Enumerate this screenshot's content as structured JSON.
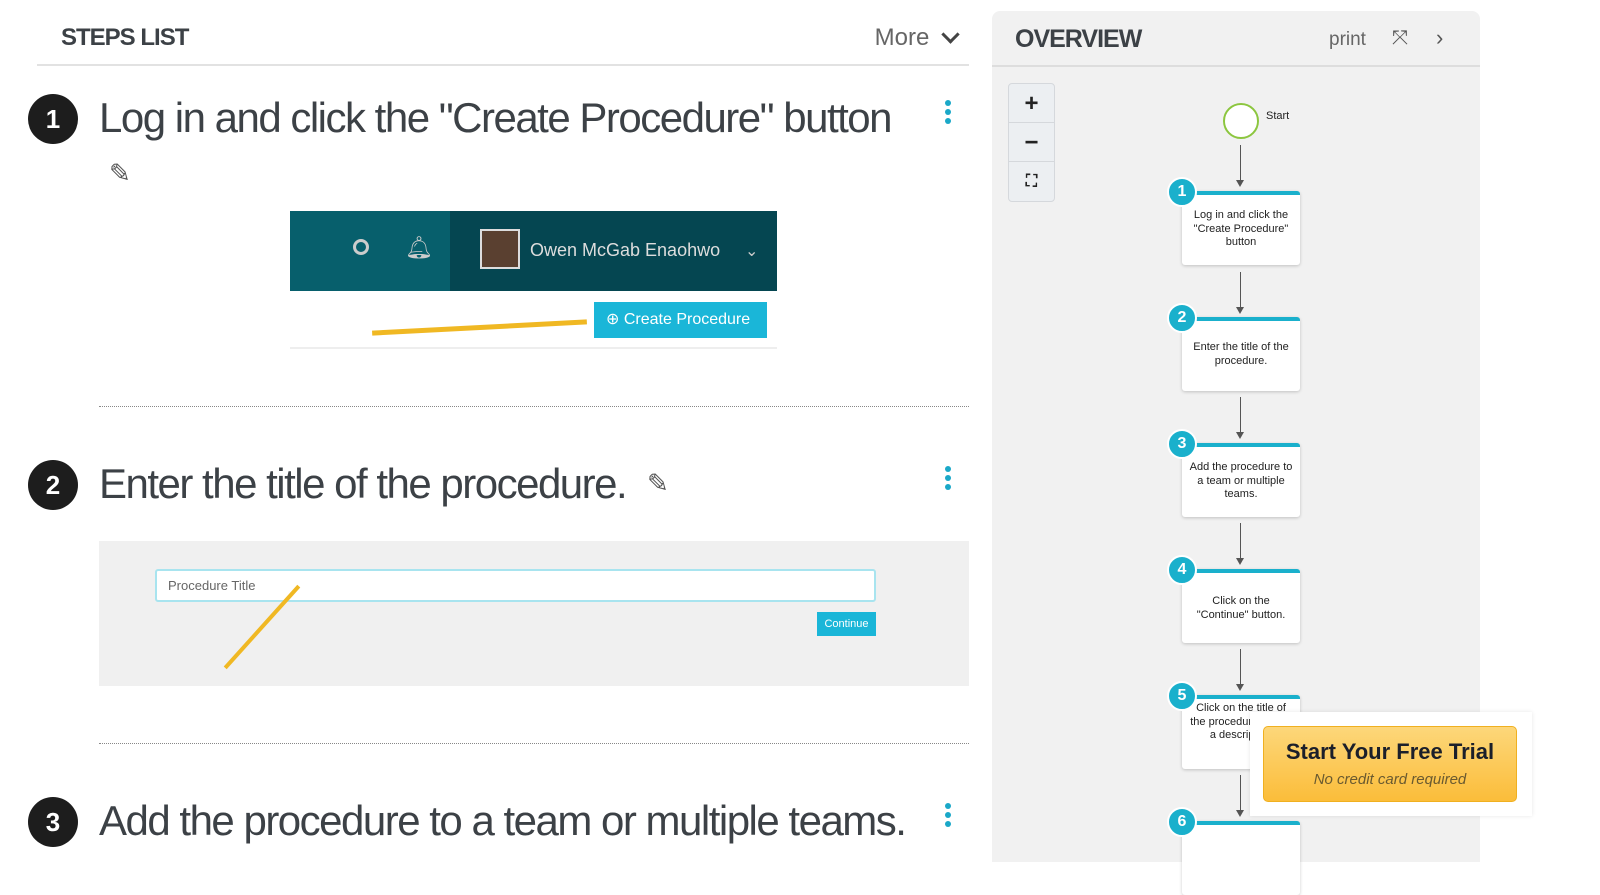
{
  "steps_list": {
    "title": "STEPS LIST",
    "more_label": "More"
  },
  "steps": [
    {
      "number": "1",
      "title": "Log in and click the \"Create Procedure\" button"
    },
    {
      "number": "2",
      "title": "Enter the title of the procedure."
    },
    {
      "number": "3",
      "title": "Add the procedure to a team or multiple teams."
    }
  ],
  "screenshot1": {
    "user_name": "Owen McGab Enaohwo",
    "create_button": "Create Procedure"
  },
  "screenshot2": {
    "placeholder": "Procedure Title",
    "continue_button": "Continue"
  },
  "overview": {
    "title": "OVERVIEW",
    "print_label": "print",
    "start_label": "Start",
    "zoom_in": "+",
    "zoom_out": "−",
    "nodes": [
      {
        "number": "1",
        "text": "Log in and click the \"Create Procedure\" button"
      },
      {
        "number": "2",
        "text": "Enter the title of the procedure."
      },
      {
        "number": "3",
        "text": "Add the procedure to a team or multiple teams."
      },
      {
        "number": "4",
        "text": "Click on the \"Continue\" button."
      },
      {
        "number": "5",
        "text": "Click on the title of the procedure to add a description"
      },
      {
        "number": "6",
        "text": ""
      }
    ]
  },
  "trial": {
    "title": "Start Your Free Trial",
    "subtitle": "No credit card required"
  },
  "colors": {
    "accent": "#1ab0cc",
    "dark_teal": "#064d5a",
    "trial": "#fbbd3a"
  }
}
